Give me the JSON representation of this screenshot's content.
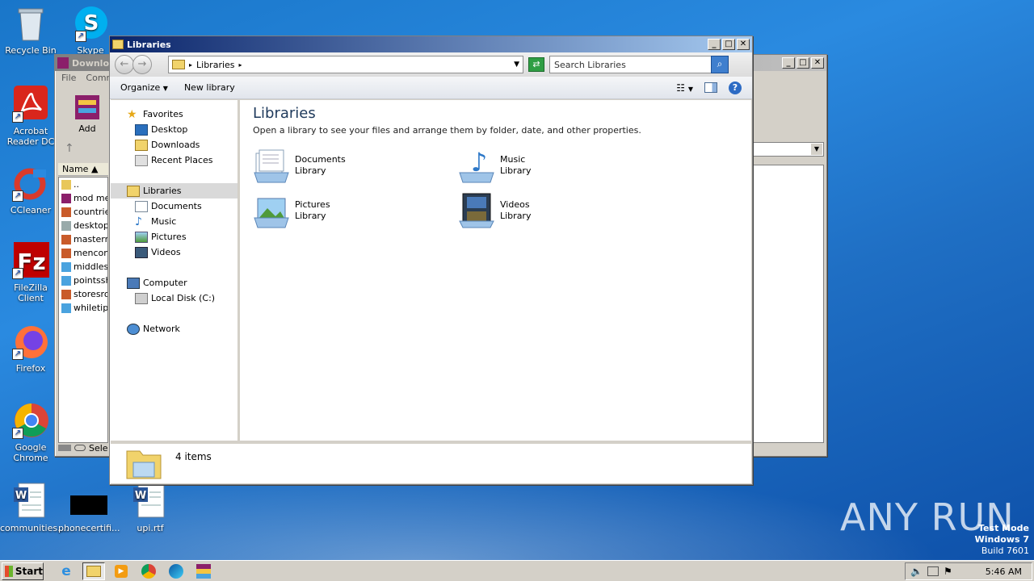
{
  "desktop": {
    "icons": [
      {
        "label": "Recycle Bin"
      },
      {
        "label": "Skype"
      },
      {
        "label": "Acrobat Reader DC"
      },
      {
        "label": "CCleaner"
      },
      {
        "label": "FileZilla Client"
      },
      {
        "label": "Firefox"
      },
      {
        "label": "Google Chrome"
      },
      {
        "label": "communities...."
      },
      {
        "label": "phonecertifi..."
      },
      {
        "label": "upi.rtf"
      }
    ]
  },
  "back_window": {
    "title": "Downlo...",
    "menu": [
      "File",
      "Comm..."
    ],
    "add_label": "Add",
    "column_name": "Name",
    "status_text": "Sele",
    "rows": [
      "..",
      "mod mer",
      "countrie",
      "desktop",
      "masterre",
      "mencom",
      "middlese",
      "pointssh",
      "storesro",
      "whiletips"
    ]
  },
  "explorer": {
    "title": "Libraries",
    "address": "Libraries",
    "search_placeholder": "Search Libraries",
    "toolbar": {
      "organize": "Organize",
      "new_library": "New library"
    },
    "nav": {
      "favorites": "Favorites",
      "desktop": "Desktop",
      "downloads": "Downloads",
      "recent": "Recent Places",
      "libraries": "Libraries",
      "documents": "Documents",
      "music": "Music",
      "pictures": "Pictures",
      "videos": "Videos",
      "computer": "Computer",
      "local_disk": "Local Disk (C:)",
      "network": "Network"
    },
    "heading": "Libraries",
    "subheading": "Open a library to see your files and arrange them by folder, date, and other properties.",
    "libraries": [
      {
        "name": "Documents",
        "type": "Library"
      },
      {
        "name": "Music",
        "type": "Library"
      },
      {
        "name": "Pictures",
        "type": "Library"
      },
      {
        "name": "Videos",
        "type": "Library"
      }
    ],
    "status": "4 items"
  },
  "taskbar": {
    "start": "Start",
    "clock": "5:46 AM"
  },
  "watermark": {
    "line1": "Test Mode",
    "line2": "Windows 7",
    "line3": "Build 7601",
    "brand": "ANY RUN"
  }
}
